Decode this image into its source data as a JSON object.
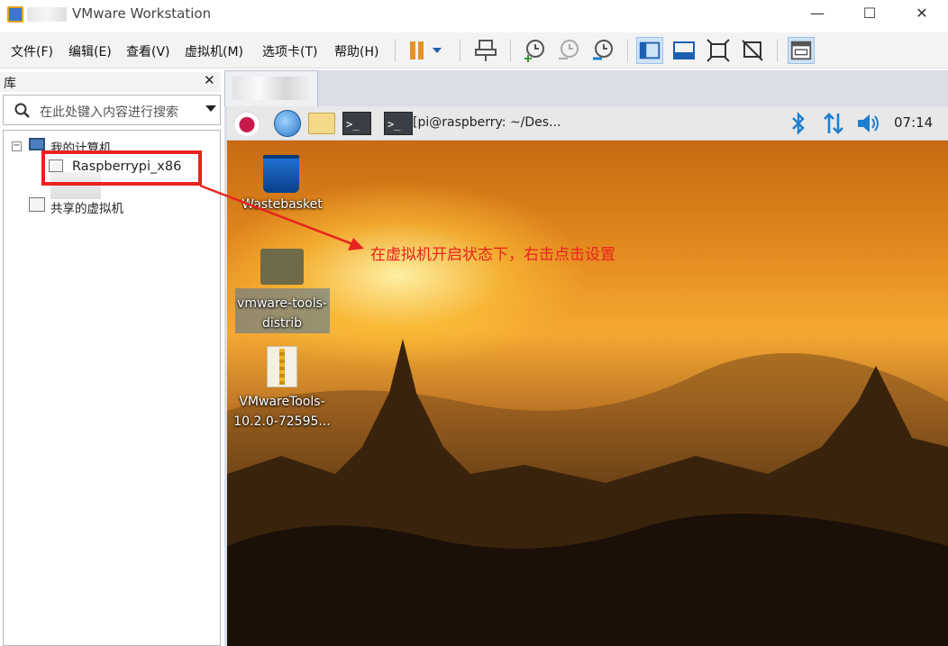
{
  "window": {
    "title": "VMware Workstation",
    "minimize": "—",
    "maximize": "☐",
    "close": "✕"
  },
  "menu": {
    "items": [
      "文件(F)",
      "编辑(E)",
      "查看(V)",
      "虚拟机(M)",
      "选项卡(T)",
      "帮助(H)"
    ]
  },
  "library": {
    "title": "库",
    "close": "✕",
    "search_placeholder": "在此处键入内容进行搜索",
    "tree": {
      "root_label": "我的计算机",
      "vm_label": "Raspberrypi_x86",
      "shared_label": "共享的虚拟机",
      "expander": "−"
    }
  },
  "guest": {
    "terminal_glyph": ">_",
    "terminal_title": "[pi@raspberry: ~/Des...",
    "clock": "07:14",
    "status_icons": [
      "bluetooth-icon",
      "network-icon",
      "volume-icon"
    ],
    "desktop_icons": [
      {
        "label": "Wastebasket"
      },
      {
        "label_line1": "vmware-tools-",
        "label_line2": "distrib"
      },
      {
        "label_line1": "VMwareTools-",
        "label_line2": "10.2.0-72595..."
      }
    ]
  },
  "annotation": {
    "text": "在虚拟机开启状态下，右击点击设置",
    "color": "#e8231f"
  },
  "colors": {
    "accent": "#1e7fd0",
    "annotation_red": "#e8231f"
  }
}
